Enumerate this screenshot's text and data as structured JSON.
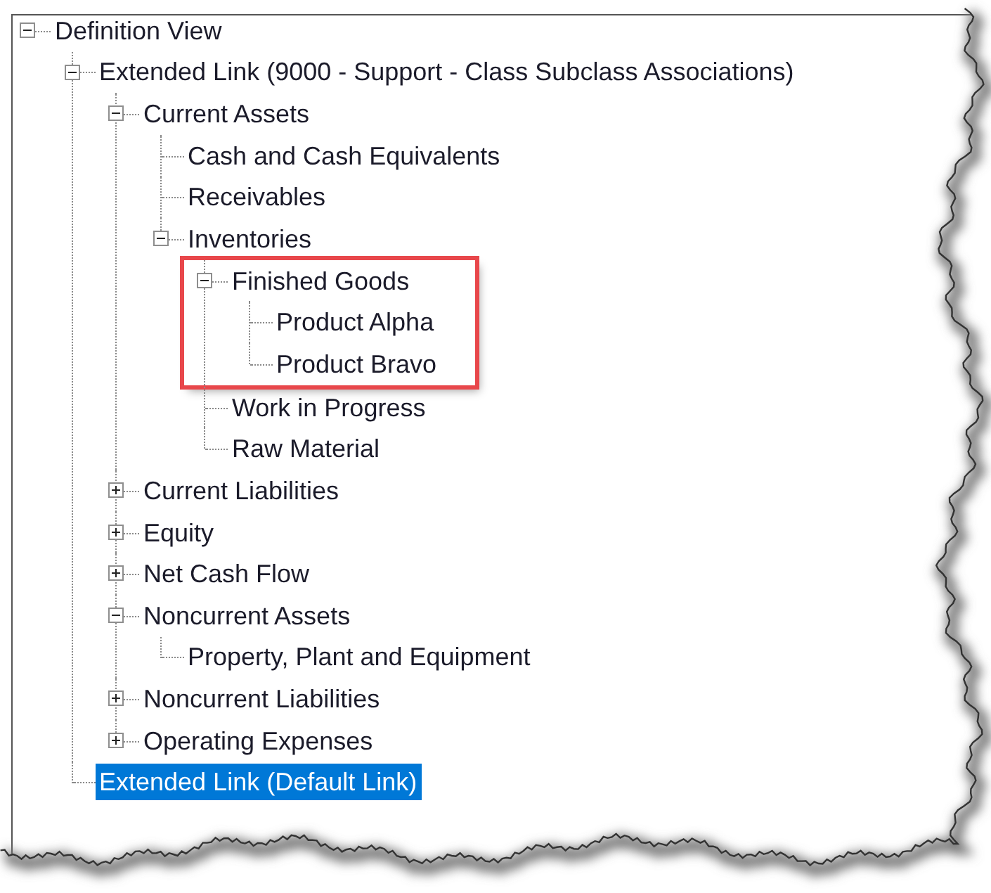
{
  "tree": {
    "nodes": [
      {
        "label": "Definition View",
        "kind": "group",
        "expanded": true,
        "selected": false,
        "highlighted": false,
        "children": [
          {
            "label": "Extended Link (9000 - Support - Class Subclass Associations)",
            "kind": "group",
            "expanded": true,
            "selected": false,
            "highlighted": false,
            "children": [
              {
                "label": "Current Assets",
                "kind": "group",
                "expanded": true,
                "selected": false,
                "highlighted": false,
                "children": [
                  {
                    "label": "Cash and Cash Equivalents",
                    "kind": "leaf",
                    "selected": false,
                    "highlighted": false
                  },
                  {
                    "label": "Receivables",
                    "kind": "leaf",
                    "selected": false,
                    "highlighted": false
                  },
                  {
                    "label": "Inventories",
                    "kind": "group",
                    "expanded": true,
                    "selected": false,
                    "highlighted": false,
                    "children": [
                      {
                        "label": "Finished Goods",
                        "kind": "group",
                        "expanded": true,
                        "selected": false,
                        "highlighted": true,
                        "children": [
                          {
                            "label": "Product Alpha",
                            "kind": "leaf",
                            "selected": false,
                            "highlighted": false
                          },
                          {
                            "label": "Product Bravo",
                            "kind": "leaf",
                            "selected": false,
                            "highlighted": false
                          }
                        ]
                      },
                      {
                        "label": "Work in Progress",
                        "kind": "leaf",
                        "selected": false,
                        "highlighted": false
                      },
                      {
                        "label": "Raw Material",
                        "kind": "leaf",
                        "selected": false,
                        "highlighted": false
                      }
                    ]
                  }
                ]
              },
              {
                "label": "Current Liabilities",
                "kind": "group",
                "expanded": false,
                "selected": false,
                "highlighted": false
              },
              {
                "label": "Equity",
                "kind": "group",
                "expanded": false,
                "selected": false,
                "highlighted": false
              },
              {
                "label": "Net Cash Flow",
                "kind": "group",
                "expanded": false,
                "selected": false,
                "highlighted": false
              },
              {
                "label": "Noncurrent Assets",
                "kind": "group",
                "expanded": true,
                "selected": false,
                "highlighted": false,
                "children": [
                  {
                    "label": "Property, Plant and Equipment",
                    "kind": "leaf",
                    "selected": false,
                    "highlighted": false
                  }
                ]
              },
              {
                "label": "Noncurrent Liabilities",
                "kind": "group",
                "expanded": false,
                "selected": false,
                "highlighted": false
              },
              {
                "label": "Operating Expenses",
                "kind": "group",
                "expanded": false,
                "selected": false,
                "highlighted": false
              }
            ]
          },
          {
            "label": "Extended Link (Default Link)",
            "kind": "leaf",
            "selected": true,
            "highlighted": false
          }
        ]
      }
    ]
  }
}
